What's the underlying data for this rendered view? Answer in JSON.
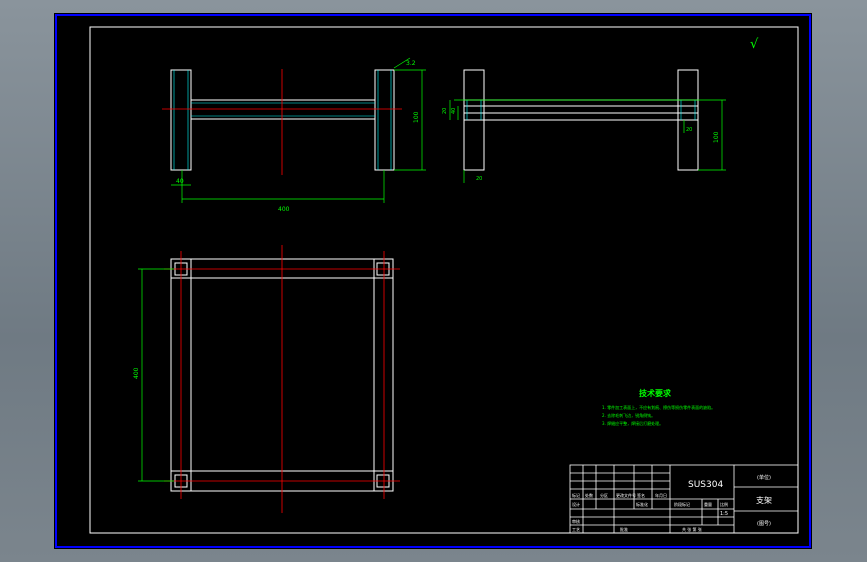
{
  "colors": {
    "background": "#000000",
    "sheet_border": "#0000ff",
    "geometry": "#ffffff",
    "centerline": "#ff0000",
    "dimension": "#00ff00"
  },
  "drawing": {
    "surface_finish_mark": "√",
    "dimensions": {
      "front_width": "400",
      "front_height": "100",
      "front_leg": "40",
      "front_roughness": "3.2",
      "side_tube": "20",
      "side_height": "100",
      "side_small_1": "20",
      "side_small_2": "40",
      "side_corner": "20",
      "plan_depth": "400"
    }
  },
  "tech_requirements": {
    "title": "技术要求",
    "items": [
      "1. 零件加工表面上，不应有划痕、擦伤等损伤零件表面的缺陷。",
      "2. 去除毛刺飞边，锐角倒钝。",
      "3. 焊缝应平整，焊接后打磨处理。"
    ]
  },
  "title_block": {
    "material": "SUS304",
    "unit_name": "(单位)",
    "part_name": "支架",
    "drawing_no": "(图号)",
    "scale": "1:5",
    "labels": {
      "mark": "标记",
      "count": "处数",
      "zone": "分区",
      "change_doc": "更改文件号",
      "signature": "签名",
      "date": "年月日",
      "design": "设计",
      "standardize": "标准化",
      "review": "审核",
      "process": "工艺",
      "approve": "批准",
      "stage_mark": "阶段标记",
      "weight": "重量",
      "scale_label": "比例",
      "sheets": "共 张 第 张"
    }
  }
}
